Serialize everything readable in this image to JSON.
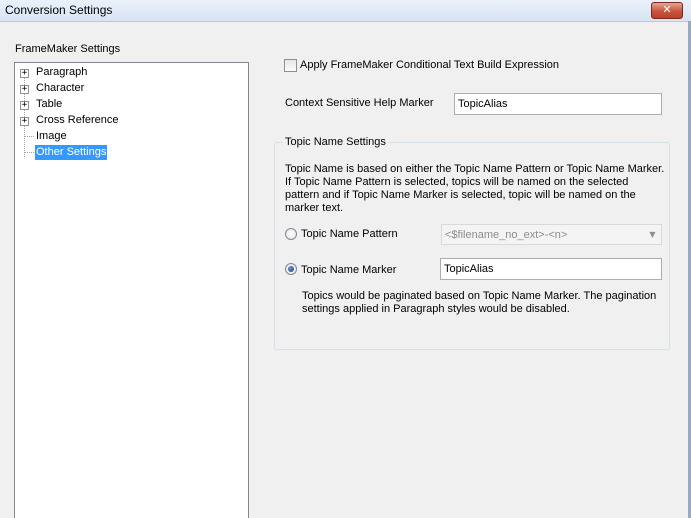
{
  "window": {
    "title": "Conversion Settings",
    "close_icon": "✕"
  },
  "left_panel": {
    "label": "FrameMaker Settings",
    "tree": [
      {
        "label": "Paragraph",
        "expandable": true
      },
      {
        "label": "Character",
        "expandable": true
      },
      {
        "label": "Table",
        "expandable": true
      },
      {
        "label": "Cross Reference",
        "expandable": true
      },
      {
        "label": "Image",
        "expandable": false
      },
      {
        "label": "Other Settings",
        "expandable": false,
        "selected": true
      }
    ],
    "expander_glyph": "+"
  },
  "options": {
    "conditional_text_label": "Apply FrameMaker Conditional Text Build Expression",
    "conditional_text_checked": false,
    "cshm_label": "Context Sensitive Help Marker",
    "cshm_value": "TopicAlias"
  },
  "topic_name": {
    "group_title": "Topic Name Settings",
    "description": "Topic Name is based on either the Topic Name Pattern or Topic Name Marker. If Topic Name Pattern is selected, topics will be named on the selected pattern and if Topic Name Marker is selected, topic will be named on the marker text.",
    "pattern_label": "Topic Name Pattern",
    "pattern_value": "<$filename_no_ext>-<n>",
    "pattern_selected": false,
    "marker_label": "Topic Name Marker",
    "marker_value": "TopicAlias",
    "marker_selected": true,
    "note": "Topics would be paginated based on Topic Name Marker. The pagination settings applied in Paragraph styles would be disabled.",
    "dropdown_icon": "▼"
  }
}
